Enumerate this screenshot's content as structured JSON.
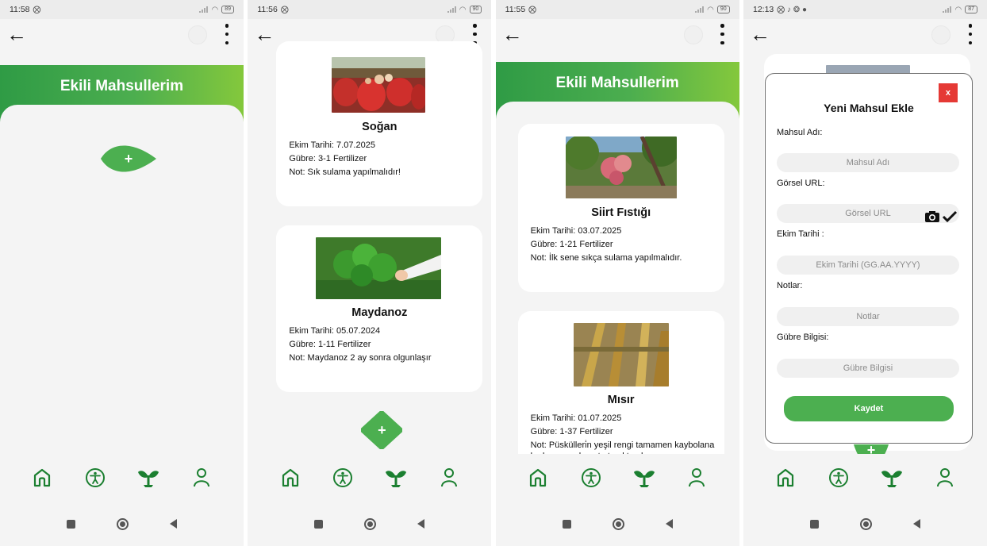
{
  "screens": [
    {
      "status": {
        "time": "11:58",
        "glyphs": "⨂",
        "battery": "89"
      },
      "header_title": "Ekili Mahsullerim",
      "add_label": "+"
    },
    {
      "status": {
        "time": "11:56",
        "glyphs": "⨂",
        "battery": "90"
      },
      "crops": [
        {
          "name": "Soğan",
          "planted": "Ekim Tarihi: 7.07.2025",
          "fertilizer": "Gübre: 3-1 Fertilizer",
          "note": "Not: Sık sulama yapılmalıdır!"
        },
        {
          "name": "Maydanoz",
          "planted": "Ekim Tarihi: 05.07.2024",
          "fertilizer": "Gübre: 1-11 Fertilizer",
          "note": "Not: Maydanoz 2 ay sonra olgunlaşır"
        }
      ],
      "add_label": "+"
    },
    {
      "status": {
        "time": "11:55",
        "glyphs": "⨂",
        "battery": "90"
      },
      "header_title": "Ekili Mahsullerim",
      "crops": [
        {
          "name": "Siirt Fıstığı",
          "planted": "Ekim Tarihi: 03.07.2025",
          "fertilizer": "Gübre: 1-21 Fertilizer",
          "note": "Not: İlk sene sıkça sulama yapılmalıdır."
        },
        {
          "name": "Mısır",
          "planted": "Ekim Tarihi: 01.07.2025",
          "fertilizer": "Gübre: 1-37 Fertilizer",
          "note": "Not: Püskülleri̇n yeşil rengi tamamen kaybolana kadar mısırı hasat etmekten kaçının."
        }
      ]
    },
    {
      "status": {
        "time": "12:13",
        "glyphs": "⨂ ♪ ❂ ●",
        "battery": "87"
      },
      "dialog": {
        "close_label": "x",
        "title": "Yeni Mahsul Ekle",
        "fields": [
          {
            "label": "Mahsul Adı:",
            "placeholder": "Mahsul Adı"
          },
          {
            "label": "Görsel URL:",
            "placeholder": "Görsel URL"
          },
          {
            "label": "Ekim Tarihi :",
            "placeholder": "Ekim Tarihi (GG.AA.YYYY)"
          },
          {
            "label": "Notlar:",
            "placeholder": "Notlar"
          },
          {
            "label": "Gübre Bilgisi:",
            "placeholder": "Gübre Bilgisi"
          }
        ],
        "save_label": "Kaydet"
      },
      "add_label": "+"
    }
  ],
  "nav_icons": [
    "home-icon",
    "accessibility-icon",
    "sprout-icon",
    "profile-icon"
  ],
  "colors": {
    "primary_green": "#4caf50",
    "dark_green": "#2f9b45",
    "light_green": "#84c83c",
    "nav_icon_green": "#1b7f30",
    "close_red": "#e53935"
  }
}
